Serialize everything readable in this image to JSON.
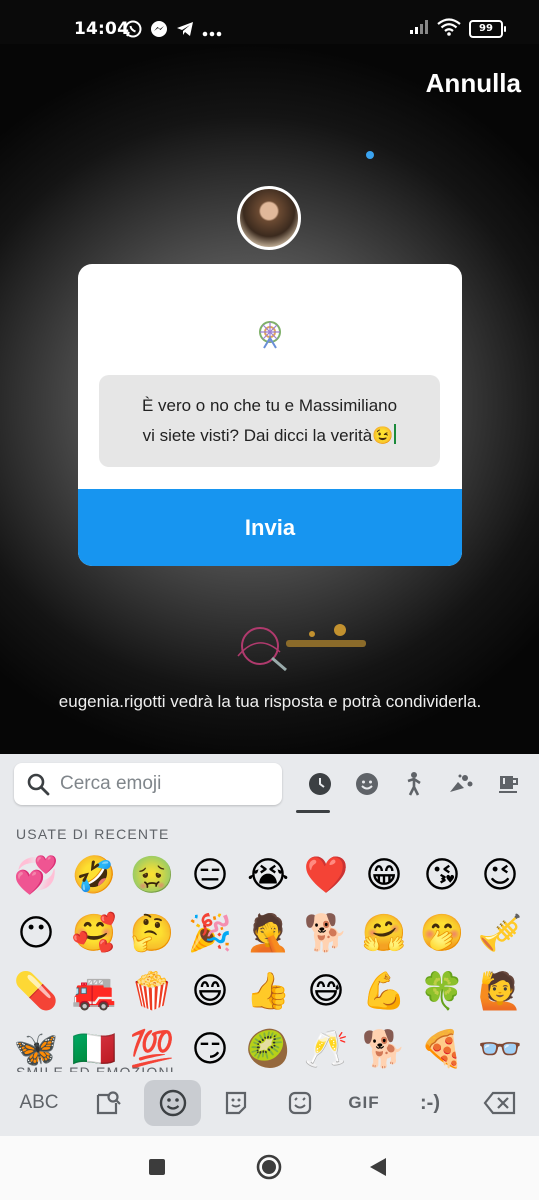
{
  "status_bar": {
    "time": "14:04",
    "battery": "99"
  },
  "story": {
    "cancel_label": "Annulla",
    "question_text": "È vero o no che tu e Massimiliano\nvi siete visti? Dai dicci la verità😉",
    "send_label": "Invia",
    "notice": "eugenia.rigotti vedrà la tua risposta e potrà condividerla."
  },
  "keyboard": {
    "search_placeholder": "Cerca emoji",
    "recent_label": "USATE DI RECENTE",
    "next_section_label": "SMILE ED EMOZIONI",
    "recent_emojis": [
      "💞",
      "🤣",
      "🤢",
      "😑",
      "😭",
      "❤️",
      "😁",
      "😘",
      "😉",
      "😶",
      "🥰",
      "🤔",
      "🎉",
      "🤦",
      "🐕",
      "🤗",
      "🤭",
      "🎺",
      "💊",
      "🚒",
      "🍿",
      "😄",
      "👍",
      "😅",
      "💪",
      "🍀",
      "🙋",
      "🦋",
      "🇮🇹",
      "💯",
      "😏",
      "🥝",
      "🥂",
      "🐕",
      "🍕",
      "👓"
    ],
    "bottom_keys": {
      "abc": "ABC",
      "gif": "GIF",
      "emoticon": ":-)"
    }
  },
  "colors": {
    "accent": "#1795f0",
    "card": "#ffffff",
    "keyboard_bg": "#e8eaed"
  }
}
